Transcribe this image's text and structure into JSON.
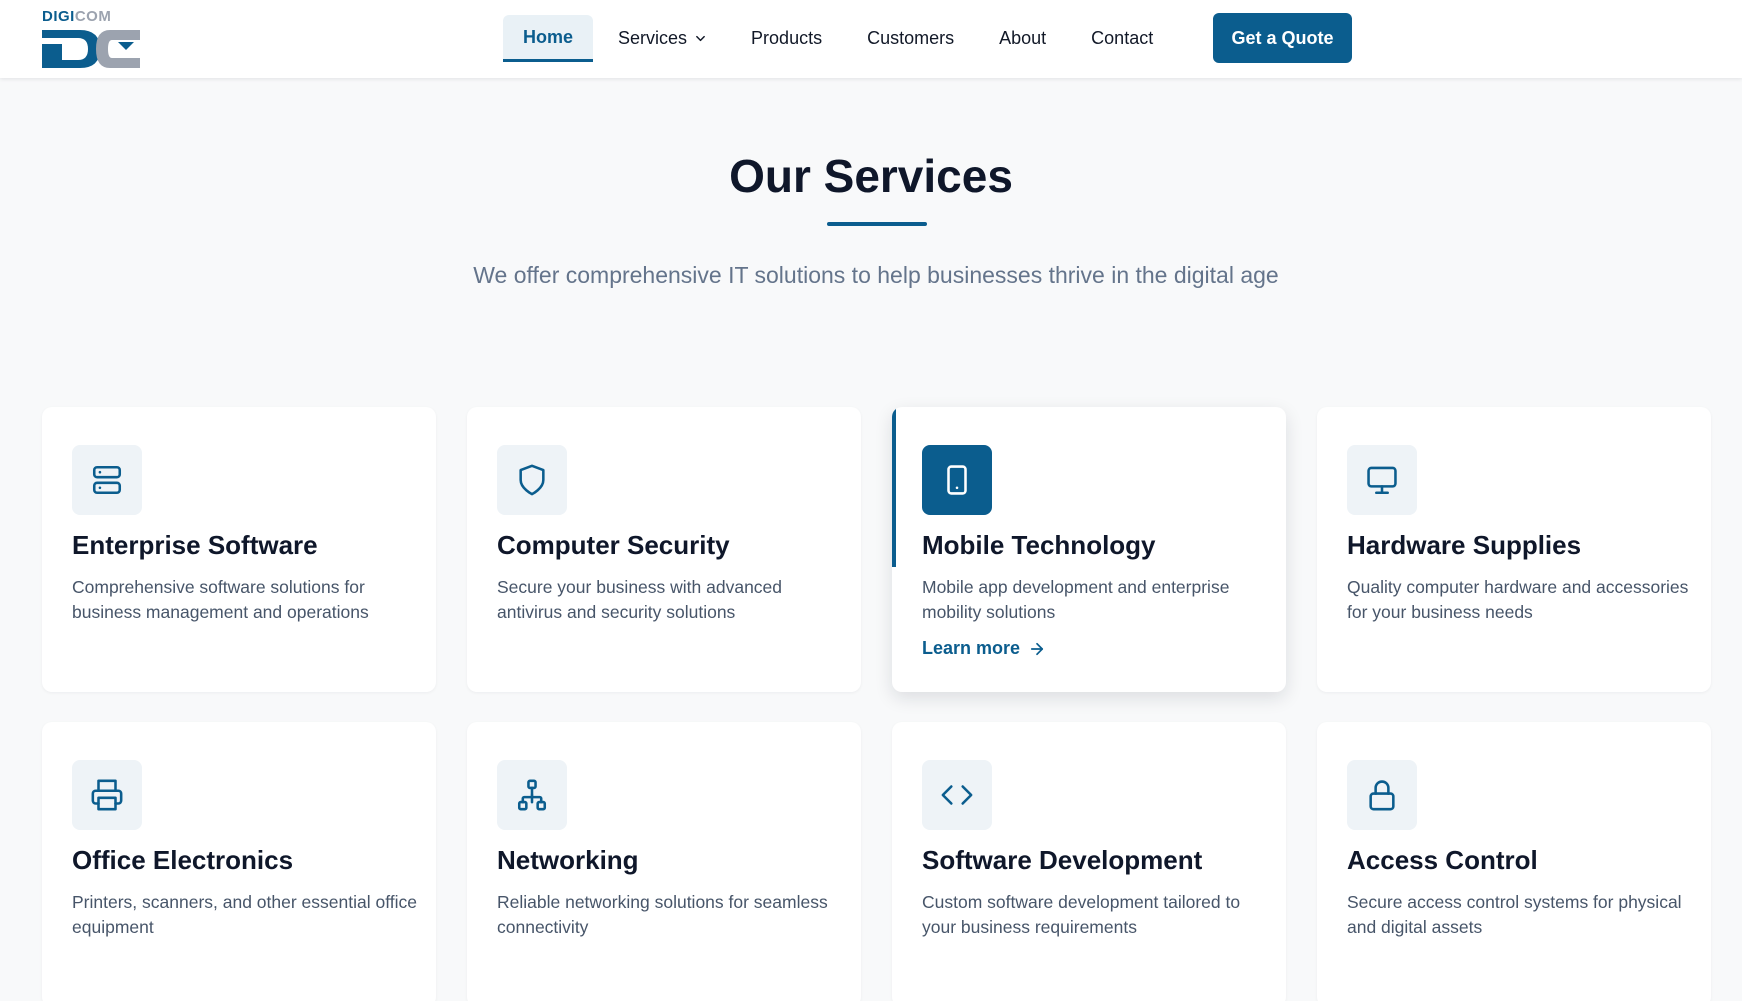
{
  "header": {
    "logo_text_a": "DIGI",
    "logo_text_b": "COM",
    "nav": [
      {
        "label": "Home",
        "active": true
      },
      {
        "label": "Services",
        "has_dropdown": true
      },
      {
        "label": "Products"
      },
      {
        "label": "Customers"
      },
      {
        "label": "About"
      },
      {
        "label": "Contact"
      }
    ],
    "cta_label": "Get a Quote"
  },
  "section": {
    "title": "Our Services",
    "subtitle": "We offer comprehensive IT solutions to help businesses thrive in the digital age"
  },
  "services": [
    {
      "title": "Enterprise Software",
      "desc": "Comprehensive software solutions for business management and operations",
      "icon": "server-icon"
    },
    {
      "title": "Computer Security",
      "desc": "Secure your business with advanced antivirus and security solutions",
      "icon": "shield-icon"
    },
    {
      "title": "Mobile Technology",
      "desc": "Mobile app development and enterprise mobility solutions",
      "icon": "tablet-icon",
      "link": "Learn more"
    },
    {
      "title": "Hardware Supplies",
      "desc": "Quality computer hardware and accessories for your business needs",
      "icon": "monitor-icon"
    },
    {
      "title": "Office Electronics",
      "desc": "Printers, scanners, and other essential office equipment",
      "icon": "printer-icon"
    },
    {
      "title": "Networking",
      "desc": "Reliable networking solutions for seamless connectivity",
      "icon": "network-icon"
    },
    {
      "title": "Software Development",
      "desc": "Custom software development tailored to your business requirements",
      "icon": "code-icon"
    },
    {
      "title": "Access Control",
      "desc": "Secure access control systems for physical and digital assets",
      "icon": "lock-icon"
    }
  ],
  "colors": {
    "brand": "#0b5d8e",
    "icon_bg": "#eef3f7",
    "page_bg": "#f8f9fa"
  }
}
